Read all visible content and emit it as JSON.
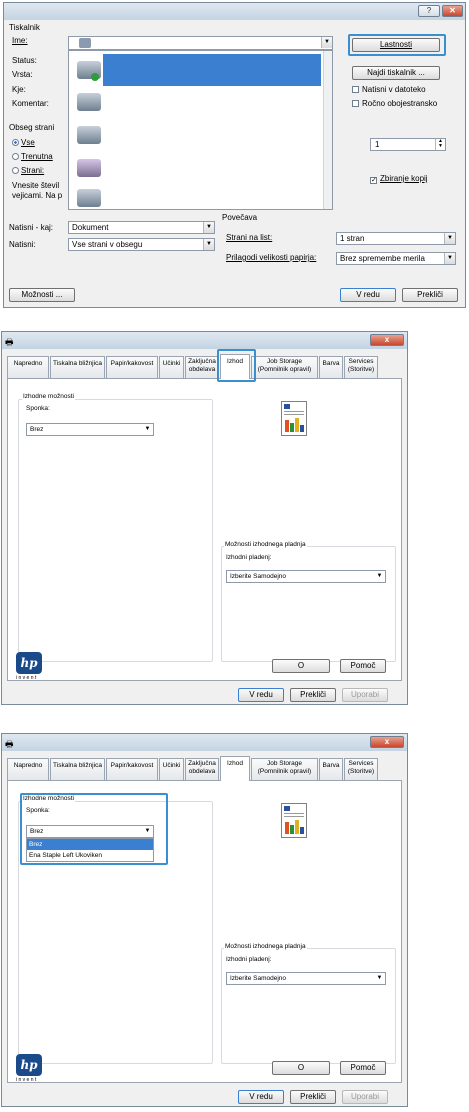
{
  "print_dialog": {
    "close_glyph": "✕",
    "help_glyph": "?",
    "printer_group": "Tiskalnik",
    "name_label": "Ime:",
    "status_label": "Status:",
    "type_label": "Vrsta:",
    "where_label": "Kje:",
    "comment_label": "Komentar:",
    "properties_button": "Lastnosti",
    "find_printer_button": "Najdi tiskalnik ...",
    "print_to_file_label": "Natisni v datoteko",
    "manual_duplex_label": "Ročno obojestransko",
    "range_group": "Obseg strani",
    "range_all": "Vse",
    "range_current": "Trenutna",
    "range_pages": "Strani:",
    "range_hint_1": "Vnesite števil",
    "range_hint_2": "vejicami. Na p",
    "copies_value": "1",
    "collate_label": "Zbiranje kopij",
    "print_what_label": "Natisni - kaj:",
    "print_what_value": "Dokument",
    "print_label": "Natisni:",
    "print_value": "Vse strani v obsegu",
    "zoom_group": "Povečava",
    "pages_per_sheet_label": "Strani na list:",
    "pages_per_sheet_value": "1 stran",
    "scale_label": "Prilagodi velikosti papirja:",
    "scale_value": "Brez spremembe merila",
    "options_button": "Možnosti ...",
    "ok_button": "V redu",
    "cancel_button": "Prekliči"
  },
  "properties": {
    "icon_glyph": "🖶",
    "tabs": [
      {
        "label1": "Napredno",
        "label2": ""
      },
      {
        "label1": "Tiskalna bližnjica",
        "label2": ""
      },
      {
        "label1": "Papir/kakovost",
        "label2": ""
      },
      {
        "label1": "Učinki",
        "label2": ""
      },
      {
        "label1": "Zaključna",
        "label2": "obdelava"
      },
      {
        "label1": "Izhod",
        "label2": ""
      },
      {
        "label1": "Job Storage",
        "label2": "(Pomnilnik opravil)"
      },
      {
        "label1": "Barva",
        "label2": ""
      },
      {
        "label1": "Services",
        "label2": "(Storitve)"
      }
    ],
    "output_group": "Izhodne možnosti",
    "staple_label": "Sponka:",
    "staple_value": "Brez",
    "staple_options": [
      "Brez",
      "Ena Staple Left Ukoviken"
    ],
    "tray_group": "Možnosti izhodnega pladnja",
    "tray_label": "Izhodni pladenj:",
    "tray_value": "Izberite Samodejno",
    "hp_logo": "hp",
    "hp_tagline": "i n v e n t",
    "about_button": "O",
    "help_button": "Pomoč",
    "ok_button": "V redu",
    "cancel_button": "Prekliči",
    "apply_button": "Uporabi"
  }
}
